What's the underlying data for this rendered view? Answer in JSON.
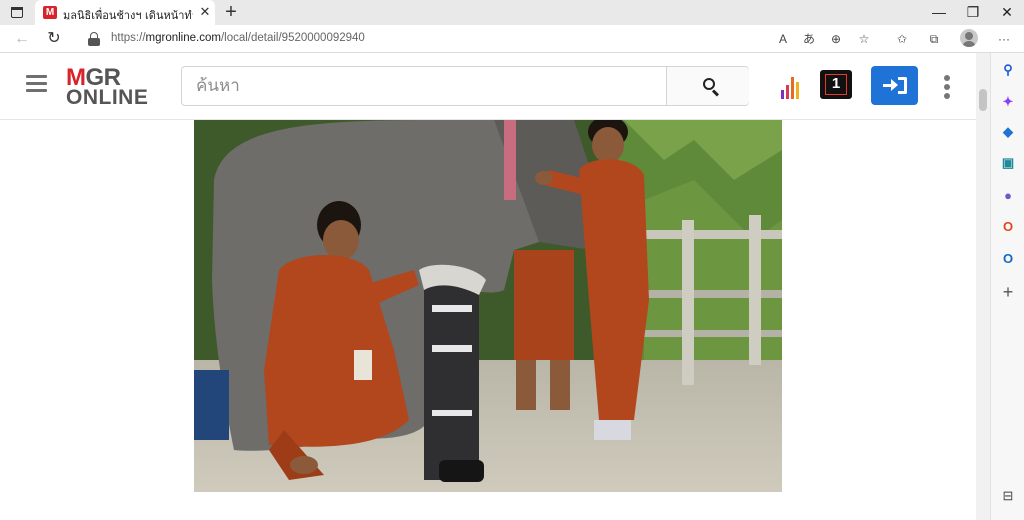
{
  "browser": {
    "tab": {
      "favicon_text": "M",
      "title": "มูลนิธิเพื่อนช้างฯ เดินหน้าทำขาเทียมให้ช้าง",
      "close_glyph": "✕"
    },
    "new_tab_glyph": "+",
    "window_controls": {
      "minimize": "—",
      "restore": "❐",
      "close": "✕"
    },
    "address": {
      "prefix": "https://",
      "host": "mgronline.com",
      "path": "/local/detail/9520000092940"
    },
    "toolbar_icons": [
      "read-aloud-icon",
      "translate-icon",
      "zoom-icon",
      "favorite-add-icon",
      "favorites-icon",
      "collections-icon",
      "profile-icon",
      "more-icon"
    ],
    "toolbar_glyphs": {
      "read_aloud": "A",
      "translate": "あ",
      "zoom": "⊕",
      "favorite_add": "☆",
      "favorites": "✩",
      "collections": "⧉",
      "more": "···"
    }
  },
  "site": {
    "logo": {
      "m": "M",
      "gr": "GR",
      "online": "ONLINE"
    },
    "search": {
      "placeholder": "ค้นหา"
    },
    "colors": {
      "brand_red": "#d8232a",
      "login_blue": "#1f73d6",
      "one_red": "#e9392c"
    },
    "one_label": "1"
  },
  "sidebar": {
    "items": [
      {
        "name": "search",
        "glyph": "⚲",
        "color": "#1f5bd6"
      },
      {
        "name": "copilot",
        "glyph": "✦",
        "color": "#8a3ffc"
      },
      {
        "name": "shopping",
        "glyph": "◆",
        "color": "#1f73d6"
      },
      {
        "name": "tools",
        "glyph": "▣",
        "color": "#1f8a9a"
      },
      {
        "name": "games",
        "glyph": "●",
        "color": "#6a5acd"
      },
      {
        "name": "office",
        "glyph": "O",
        "color": "#e3461e"
      },
      {
        "name": "outlook",
        "glyph": "O",
        "color": "#0f6cbd"
      },
      {
        "name": "add",
        "glyph": "+",
        "color": "#555555"
      }
    ],
    "bottom_glyph": "⊟"
  }
}
